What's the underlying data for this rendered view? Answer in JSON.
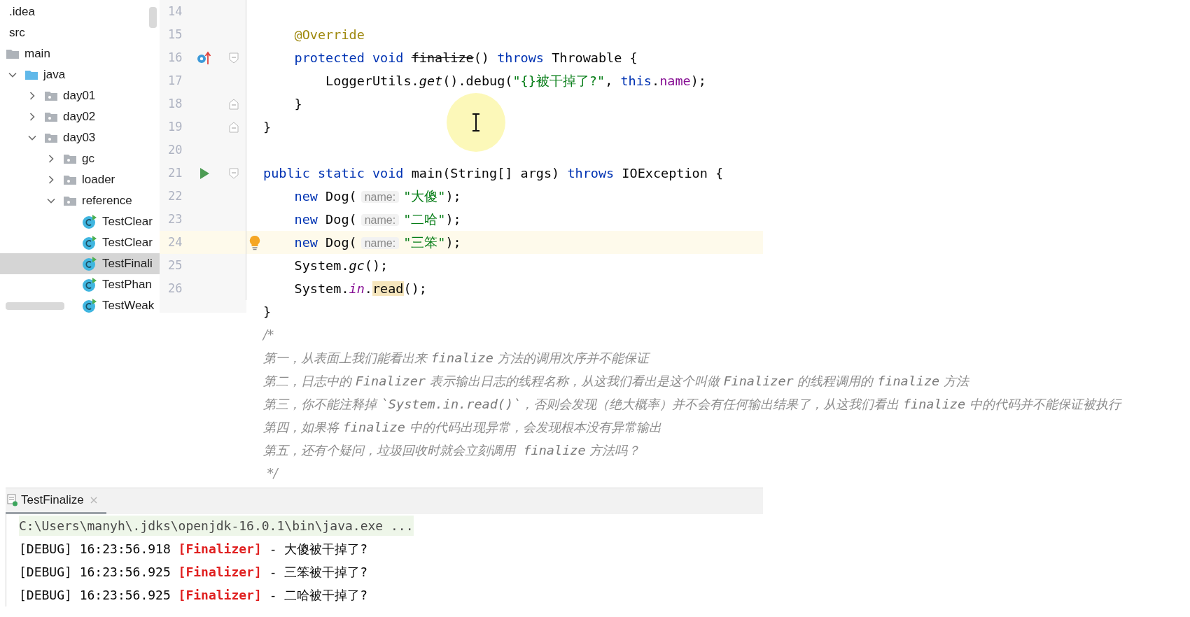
{
  "project_tree": {
    "items": [
      {
        "label": ".idea",
        "kind": "plain",
        "selected": false
      },
      {
        "label": "src",
        "kind": "plain",
        "selected": false
      },
      {
        "label": "main",
        "kind": "folder",
        "selected": false
      },
      {
        "label": "java",
        "kind": "source-folder",
        "expanded": true,
        "selected": false,
        "children": [
          {
            "label": "day01",
            "kind": "package",
            "expanded": false,
            "selected": false
          },
          {
            "label": "day02",
            "kind": "package",
            "expanded": false,
            "selected": false
          },
          {
            "label": "day03",
            "kind": "package",
            "expanded": true,
            "selected": false,
            "children": [
              {
                "label": "gc",
                "kind": "package",
                "expanded": false,
                "selected": false
              },
              {
                "label": "loader",
                "kind": "package",
                "expanded": false,
                "selected": false
              },
              {
                "label": "reference",
                "kind": "package",
                "expanded": true,
                "selected": false,
                "children": [
                  {
                    "label": "TestClear",
                    "kind": "class",
                    "selected": false
                  },
                  {
                    "label": "TestClear",
                    "kind": "class",
                    "selected": false
                  },
                  {
                    "label": "TestFinali",
                    "kind": "class",
                    "selected": true
                  },
                  {
                    "label": "TestPhan",
                    "kind": "class",
                    "selected": false
                  },
                  {
                    "label": "TestWeak",
                    "kind": "class",
                    "selected": false
                  }
                ]
              }
            ]
          }
        ]
      }
    ]
  },
  "editor": {
    "lines": [
      {
        "number": "14",
        "current": false
      },
      {
        "number": "15",
        "current": false,
        "tokens": [
          {
            "kind": "annotation",
            "text": "    @Override"
          }
        ]
      },
      {
        "number": "16",
        "current": false,
        "marker": {
          "kind": "override"
        },
        "fold": {
          "kind": "open"
        },
        "tokens": [
          {
            "kind": "keyword",
            "text": "    protected void "
          },
          {
            "kind": "deprecated",
            "text": "finalize"
          },
          {
            "kind": "plain",
            "text": "() "
          },
          {
            "kind": "keyword",
            "text": "throws "
          },
          {
            "kind": "plain",
            "text": "Throwable {"
          }
        ]
      },
      {
        "number": "17",
        "current": false,
        "tokens": [
          {
            "kind": "plain",
            "text": "        LoggerUtils."
          },
          {
            "kind": "static-call",
            "text": "get"
          },
          {
            "kind": "plain",
            "text": "().debug("
          },
          {
            "kind": "string",
            "text": "\"{}被干掉了?\""
          },
          {
            "kind": "plain",
            "text": ", "
          },
          {
            "kind": "keyword",
            "text": "this"
          },
          {
            "kind": "plain",
            "text": "."
          },
          {
            "kind": "field",
            "text": "name"
          },
          {
            "kind": "plain",
            "text": ");"
          }
        ]
      },
      {
        "number": "18",
        "current": false,
        "fold": {
          "kind": "close"
        },
        "tokens": [
          {
            "kind": "plain",
            "text": "    }"
          }
        ]
      },
      {
        "number": "19",
        "current": false,
        "fold": {
          "kind": "close"
        },
        "tokens": [
          {
            "kind": "plain",
            "text": "}"
          }
        ]
      },
      {
        "number": "20",
        "current": false
      },
      {
        "number": "21",
        "current": false,
        "marker": {
          "kind": "run"
        },
        "fold": {
          "kind": "open"
        },
        "tokens": [
          {
            "kind": "keyword",
            "text": "public static void "
          },
          {
            "kind": "plain",
            "text": "main(String[] args) "
          },
          {
            "kind": "keyword",
            "text": "throws "
          },
          {
            "kind": "plain",
            "text": "IOException {"
          }
        ]
      },
      {
        "number": "22",
        "current": false,
        "tokens": [
          {
            "kind": "keyword",
            "text": "    new "
          },
          {
            "kind": "plain",
            "text": "Dog("
          },
          {
            "kind": "hint",
            "text": "name:"
          },
          {
            "kind": "string",
            "text": "\"大傻\""
          },
          {
            "kind": "plain",
            "text": ");"
          }
        ]
      },
      {
        "number": "23",
        "current": false,
        "tokens": [
          {
            "kind": "keyword",
            "text": "    new "
          },
          {
            "kind": "plain",
            "text": "Dog("
          },
          {
            "kind": "hint",
            "text": "name:"
          },
          {
            "kind": "string",
            "text": "\"二哈\""
          },
          {
            "kind": "plain",
            "text": ");"
          }
        ]
      },
      {
        "number": "24",
        "current": true,
        "intention": true,
        "tokens": [
          {
            "kind": "keyword",
            "text": "    new "
          },
          {
            "kind": "plain",
            "text": "Dog("
          },
          {
            "kind": "hint",
            "text": "name:"
          },
          {
            "kind": "string",
            "text": "\"三笨\""
          },
          {
            "kind": "plain",
            "text": ");"
          }
        ]
      },
      {
        "number": "25",
        "current": false,
        "tokens": [
          {
            "kind": "plain",
            "text": "    System."
          },
          {
            "kind": "static-call",
            "text": "gc"
          },
          {
            "kind": "plain",
            "text": "();"
          }
        ]
      },
      {
        "number": "26",
        "current": false,
        "tokens": [
          {
            "kind": "plain",
            "text": "    System."
          },
          {
            "kind": "static-field",
            "text": "in"
          },
          {
            "kind": "plain",
            "text": "."
          },
          {
            "kind": "highlighted",
            "text": "read"
          },
          {
            "kind": "plain",
            "text": "();"
          }
        ]
      },
      {
        "current": false,
        "tokens": [
          {
            "kind": "plain",
            "text": "}"
          }
        ]
      },
      {
        "current": false,
        "tokens": [
          {
            "kind": "comment",
            "text": "/*"
          }
        ]
      },
      {
        "current": false,
        "tokens": [
          {
            "kind": "comment",
            "text": "第一，从表面上我们能看出来 "
          },
          {
            "kind": "comment-code",
            "text": "finalize"
          },
          {
            "kind": "comment",
            "text": " 方法的调用次序并不能保证"
          }
        ]
      },
      {
        "current": false,
        "tokens": [
          {
            "kind": "comment",
            "text": "第二，日志中的 "
          },
          {
            "kind": "comment-code",
            "text": "Finalizer"
          },
          {
            "kind": "comment",
            "text": " 表示输出日志的线程名称，从这我们看出是这个叫做 "
          },
          {
            "kind": "comment-code",
            "text": "Finalizer"
          },
          {
            "kind": "comment",
            "text": " 的线程调用的 "
          },
          {
            "kind": "comment-code",
            "text": "finalize"
          },
          {
            "kind": "comment",
            "text": " 方法"
          }
        ]
      },
      {
        "current": false,
        "tokens": [
          {
            "kind": "comment",
            "text": "第三，你不能注释掉 "
          },
          {
            "kind": "comment-code",
            "text": "`System.in.read()`"
          },
          {
            "kind": "comment",
            "text": "，否则会发现（绝大概率）并不会有任何输出结果了，从这我们看出 "
          },
          {
            "kind": "comment-code",
            "text": "finalize"
          },
          {
            "kind": "comment",
            "text": " 中的代码并不能保证被执行"
          }
        ]
      },
      {
        "current": false,
        "tokens": [
          {
            "kind": "comment",
            "text": "第四，如果将 "
          },
          {
            "kind": "comment-code",
            "text": "finalize"
          },
          {
            "kind": "comment",
            "text": " 中的代码出现异常，会发现根本没有异常输出"
          }
        ]
      },
      {
        "current": false,
        "tokens": [
          {
            "kind": "comment",
            "text": "第五，还有个疑问，垃圾回收时就会立刻调用  "
          },
          {
            "kind": "comment-code",
            "text": "finalize"
          },
          {
            "kind": "comment",
            "text": " 方法吗？"
          }
        ]
      },
      {
        "current": false,
        "tokens": [
          {
            "kind": "comment",
            "text": " */"
          }
        ]
      }
    ]
  },
  "run_panel": {
    "tabs": [
      {
        "label": "TestFinalize",
        "selected": true
      }
    ],
    "lines": [
      {
        "tokens": [
          {
            "kind": "command",
            "text": "C:\\Users\\manyh\\.jdks\\openjdk-16.0.1\\bin\\java.exe ..."
          }
        ]
      },
      {
        "tokens": [
          {
            "kind": "plain",
            "text": "[DEBUG] 16:23:56.918 "
          },
          {
            "kind": "thread",
            "text": "[Finalizer]"
          },
          {
            "kind": "plain",
            "text": " - 大傻被干掉了?"
          }
        ]
      },
      {
        "tokens": [
          {
            "kind": "plain",
            "text": "[DEBUG] 16:23:56.925 "
          },
          {
            "kind": "thread",
            "text": "[Finalizer]"
          },
          {
            "kind": "plain",
            "text": " - 三笨被干掉了?"
          }
        ]
      },
      {
        "tokens": [
          {
            "kind": "plain",
            "text": "[DEBUG] 16:23:56.925 "
          },
          {
            "kind": "thread",
            "text": "[Finalizer]"
          },
          {
            "kind": "plain",
            "text": " - 二哈被干掉了?"
          }
        ]
      }
    ]
  }
}
